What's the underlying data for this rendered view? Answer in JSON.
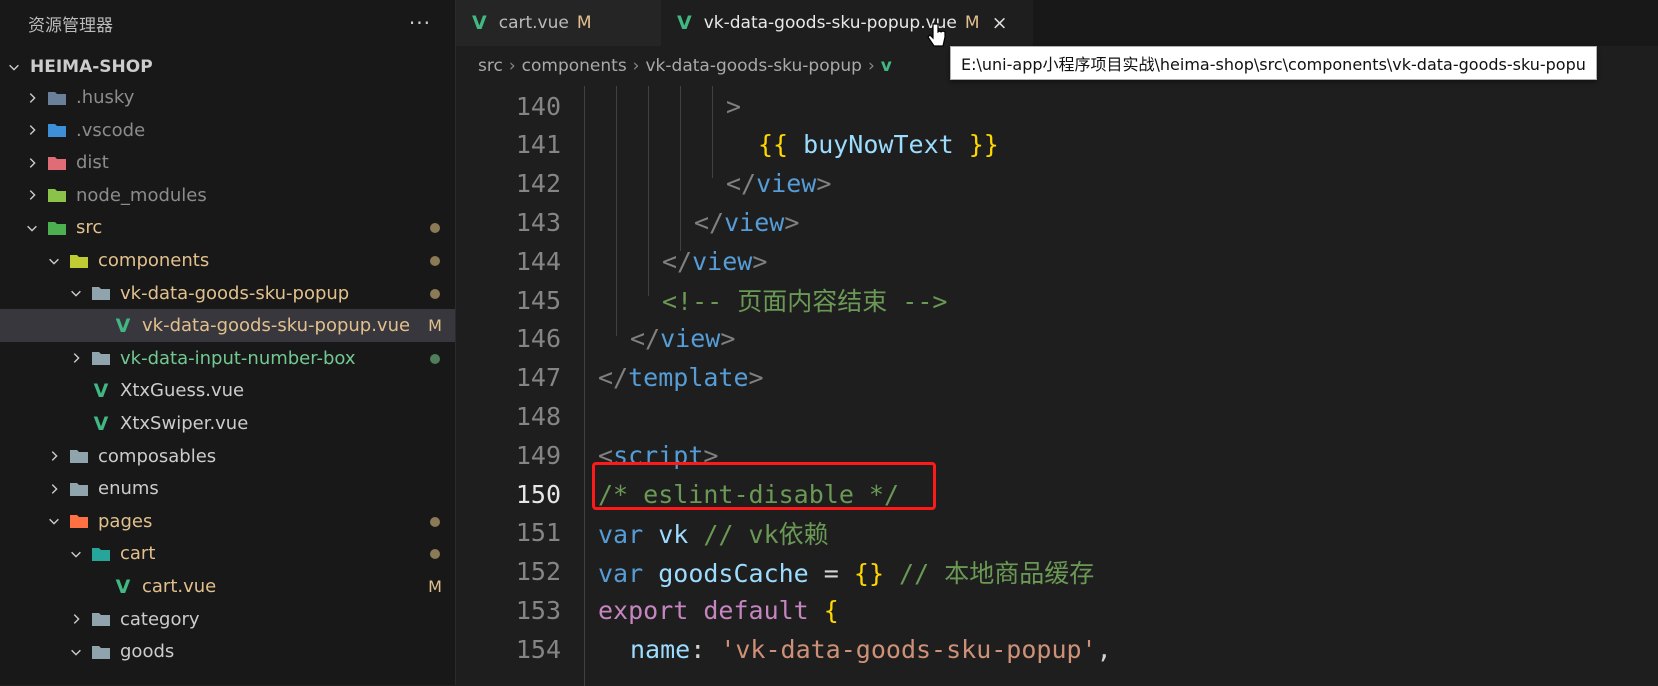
{
  "explorer": {
    "title": "资源管理器",
    "more": "···",
    "project": "HEIMA-SHOP",
    "items": [
      {
        "label": ".husky",
        "type": "folder",
        "icon": "husky-folder-icon",
        "expanded": false,
        "depth": 1
      },
      {
        "label": ".vscode",
        "type": "folder",
        "icon": "vscode-folder-icon",
        "expanded": false,
        "depth": 1
      },
      {
        "label": "dist",
        "type": "folder",
        "icon": "dist-folder-icon",
        "expanded": false,
        "depth": 1
      },
      {
        "label": "node_modules",
        "type": "folder",
        "icon": "node-folder-icon",
        "expanded": false,
        "depth": 1
      },
      {
        "label": "src",
        "type": "folder",
        "icon": "src-folder-icon",
        "expanded": true,
        "depth": 1,
        "deco": "dot"
      },
      {
        "label": "components",
        "type": "folder",
        "icon": "components-folder-icon",
        "expanded": true,
        "depth": 2,
        "deco": "dot"
      },
      {
        "label": "vk-data-goods-sku-popup",
        "type": "folder",
        "icon": "folder-icon",
        "expanded": true,
        "depth": 3,
        "deco": "dot"
      },
      {
        "label": "vk-data-goods-sku-popup.vue",
        "type": "file",
        "icon": "vue-icon",
        "depth": 4,
        "deco": "M",
        "selected": true
      },
      {
        "label": "vk-data-input-number-box",
        "type": "folder",
        "icon": "folder-icon",
        "expanded": false,
        "depth": 3,
        "deco": "dot-green"
      },
      {
        "label": "XtxGuess.vue",
        "type": "file",
        "icon": "vue-icon",
        "depth": 3
      },
      {
        "label": "XtxSwiper.vue",
        "type": "file",
        "icon": "vue-icon",
        "depth": 3
      },
      {
        "label": "composables",
        "type": "folder",
        "icon": "folder-icon",
        "expanded": false,
        "depth": 2
      },
      {
        "label": "enums",
        "type": "folder",
        "icon": "folder-icon",
        "expanded": false,
        "depth": 2
      },
      {
        "label": "pages",
        "type": "folder",
        "icon": "pages-folder-icon",
        "expanded": true,
        "depth": 2,
        "deco": "dot"
      },
      {
        "label": "cart",
        "type": "folder",
        "icon": "cart-folder-icon",
        "expanded": true,
        "depth": 3,
        "deco": "dot"
      },
      {
        "label": "cart.vue",
        "type": "file",
        "icon": "vue-icon",
        "depth": 4,
        "deco": "M"
      },
      {
        "label": "category",
        "type": "folder",
        "icon": "folder-icon",
        "expanded": false,
        "depth": 3
      },
      {
        "label": "goods",
        "type": "folder",
        "icon": "folder-icon",
        "expanded": true,
        "depth": 3
      }
    ]
  },
  "tabs": [
    {
      "label": "cart.vue",
      "modified": "M",
      "active": false
    },
    {
      "label": "vk-data-goods-sku-popup.vue",
      "modified": "M",
      "active": true,
      "close": "×"
    }
  ],
  "breadcrumbs": [
    "src",
    "components",
    "vk-data-goods-sku-popup",
    "v"
  ],
  "tooltip": "E:\\uni-app小程序项目实战\\heima-shop\\src\\components\\vk-data-goods-sku-popu",
  "code": {
    "lines": [
      {
        "n": "140",
        "tokens": [
          [
            "t-punc",
            ">"
          ]
        ]
      },
      {
        "n": "141",
        "tokens": [
          [
            "t-brace",
            "{{ "
          ],
          [
            "t-var",
            "buyNowText"
          ],
          [
            "t-brace",
            " }}"
          ]
        ]
      },
      {
        "n": "142",
        "tokens": [
          [
            "t-punc",
            "</"
          ],
          [
            "t-tag",
            "view"
          ],
          [
            "t-punc",
            ">"
          ]
        ]
      },
      {
        "n": "143",
        "tokens": [
          [
            "t-punc",
            "</"
          ],
          [
            "t-tag",
            "view"
          ],
          [
            "t-punc",
            ">"
          ]
        ]
      },
      {
        "n": "144",
        "tokens": [
          [
            "t-punc",
            "</"
          ],
          [
            "t-tag",
            "view"
          ],
          [
            "t-punc",
            ">"
          ]
        ]
      },
      {
        "n": "145",
        "tokens": [
          [
            "t-com",
            "<!-- 页面内容结束 -->"
          ]
        ]
      },
      {
        "n": "146",
        "tokens": [
          [
            "t-punc",
            "</"
          ],
          [
            "t-tag",
            "view"
          ],
          [
            "t-punc",
            ">"
          ]
        ]
      },
      {
        "n": "147",
        "tokens": [
          [
            "t-punc",
            "</"
          ],
          [
            "t-tag",
            "template"
          ],
          [
            "t-punc",
            ">"
          ]
        ]
      },
      {
        "n": "148",
        "tokens": []
      },
      {
        "n": "149",
        "tokens": [
          [
            "t-punc",
            "<"
          ],
          [
            "t-tag",
            "script"
          ],
          [
            "t-punc",
            ">"
          ]
        ]
      },
      {
        "n": "150",
        "tokens": [
          [
            "t-com",
            "/* eslint-disable */"
          ]
        ],
        "current": true
      },
      {
        "n": "151",
        "tokens": [
          [
            "t-kw",
            "var "
          ],
          [
            "t-var",
            "vk"
          ],
          [
            "t-com",
            " // vk依赖"
          ]
        ]
      },
      {
        "n": "152",
        "tokens": [
          [
            "t-kw",
            "var "
          ],
          [
            "t-var",
            "goodsCache"
          ],
          [
            "t-op",
            " = "
          ],
          [
            "t-brace",
            "{}"
          ],
          [
            "t-com",
            " // 本地商品缓存"
          ]
        ]
      },
      {
        "n": "153",
        "tokens": [
          [
            "t-exp",
            "export default "
          ],
          [
            "t-brace",
            "{"
          ]
        ]
      },
      {
        "n": "154",
        "tokens": [
          [
            "t-var",
            "name"
          ],
          [
            "t-op",
            ": "
          ],
          [
            "t-str",
            "'vk-data-goods-sku-popup'"
          ],
          [
            "t-op",
            ","
          ]
        ]
      }
    ]
  },
  "colors": {
    "accent": "#41b883",
    "modified": "#e2c08d",
    "highlight": "#ff1a1a"
  }
}
